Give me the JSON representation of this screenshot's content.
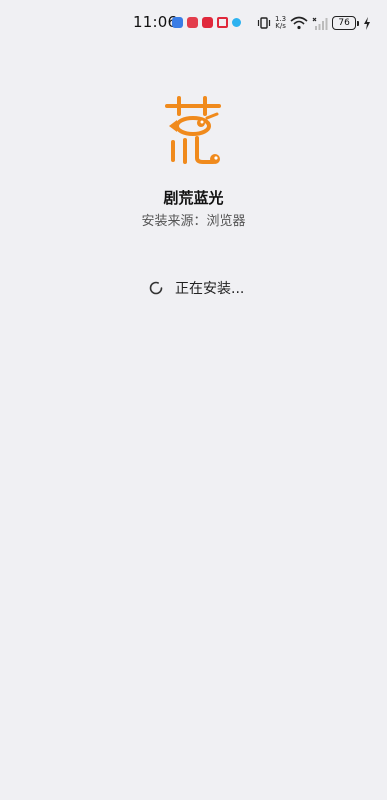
{
  "status_bar": {
    "time": "11:06",
    "net_speed_value": "1.3",
    "net_speed_unit": "K/s",
    "battery_level": "76",
    "icons": [
      "vibrate-icon",
      "wifi-icon",
      "signal-icon",
      "charging-icon"
    ]
  },
  "app": {
    "name": "剧荒蓝光",
    "source_label": "安装来源：",
    "source_value": "浏览器",
    "logo": "juhuang-logo",
    "logo_color": "#f08a1c"
  },
  "install": {
    "status_text": "正在安装..."
  }
}
